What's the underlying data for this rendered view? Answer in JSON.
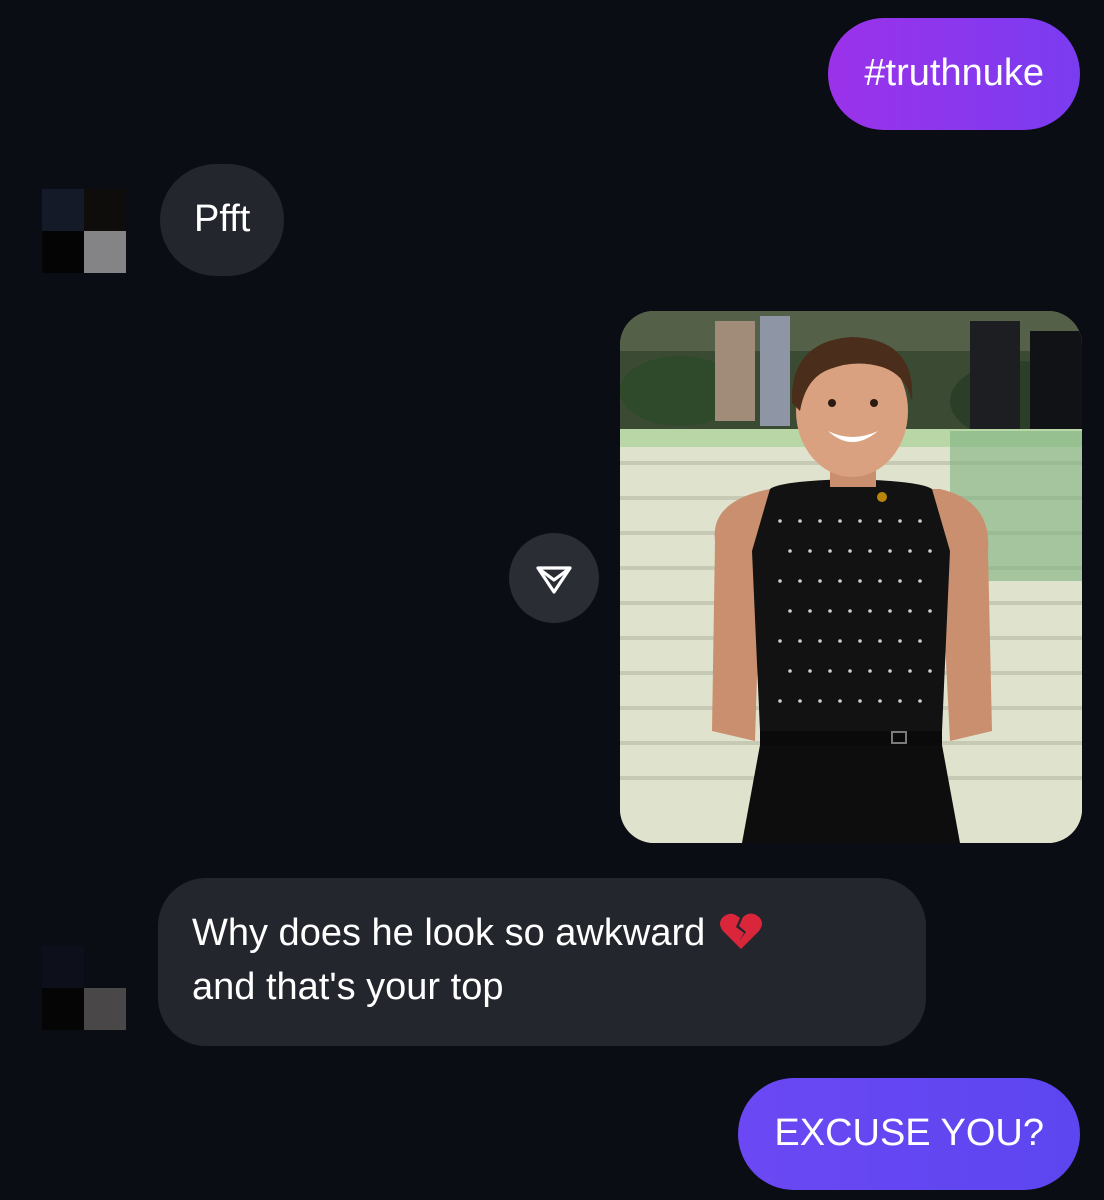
{
  "conversation": {
    "messages": [
      {
        "sender": "me",
        "text": "#truthnuke"
      },
      {
        "sender": "them",
        "text": "Pfft"
      },
      {
        "sender": "me",
        "type": "image",
        "alt": ""
      },
      {
        "sender": "them",
        "line1": "Why does he look so awkward",
        "line2": "and that's your top",
        "emoji": "broken-heart"
      },
      {
        "sender": "me",
        "text": "EXCUSE YOU?"
      }
    ]
  },
  "colors": {
    "background": "#0b0d14",
    "received_bubble": "#23262c",
    "sent_bubble_start": "#9b32ea",
    "sent_bubble_end": "#5c46f0",
    "emoji_red": "#d9263b"
  },
  "icons": {
    "share": "send-triangle-icon",
    "emoji": "broken-heart-icon"
  }
}
